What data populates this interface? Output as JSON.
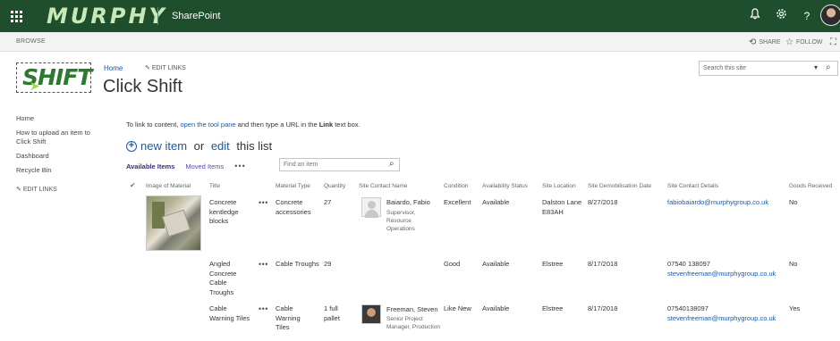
{
  "suite": {
    "brand": "MURPHY",
    "app_name": "SharePoint",
    "icons": [
      "waffle-icon",
      "bell-icon",
      "gear-icon",
      "help-icon",
      "avatar"
    ]
  },
  "ribbon": {
    "browse": "BROWSE",
    "share": "SHARE",
    "follow": "FOLLOW"
  },
  "header": {
    "logo_text": "SHIFT",
    "home": "Home",
    "edit_links": "EDIT LINKS",
    "title": "Click Shift",
    "search_placeholder": "Search this site"
  },
  "left_nav": {
    "items": [
      "Home",
      "How to upload an item to Click Shift",
      "Dashboard",
      "Recycle Bin"
    ],
    "edit_links": "EDIT LINKS"
  },
  "content": {
    "info_prefix": "To link to content, ",
    "info_link": "open the tool pane",
    "info_mid": " and then type a URL in the ",
    "info_bold": "Link",
    "info_suffix": " text box.",
    "new_item": "new item",
    "or": " or ",
    "edit": "edit",
    "this_list": " this list",
    "views": {
      "available": "Available Items",
      "moved": "Moved Items",
      "more": "•••"
    },
    "find_placeholder": "Find an item"
  },
  "table": {
    "headers": [
      "Image of Material",
      "Title",
      "Material Type",
      "Quantity",
      "Site Contact Name",
      "Condition",
      "Availability Status",
      "Site Location",
      "Site Demobilisation Date",
      "Site Contact Details",
      "Goods Received"
    ],
    "rows": [
      {
        "title": "Concrete kentledge blocks",
        "material_type": "Concrete accessories",
        "quantity": "27",
        "contact_name": "Baiardo, Fabio",
        "contact_role": "Supervisor, Resource Operations",
        "condition": "Excellent",
        "availability": "Available",
        "location": "Dalston Lane E83AH",
        "demob_date": "8/27/2018",
        "contact_phone": "",
        "contact_email": "fabiobaiardo@murphygroup.co.uk",
        "goods_received": "No"
      },
      {
        "title": "Angled Concrete Cable Troughs",
        "material_type": "Cable Troughs",
        "quantity": "29",
        "contact_name": "",
        "contact_role": "",
        "condition": "Good",
        "availability": "Available",
        "location": "Elstree",
        "demob_date": "8/17/2018",
        "contact_phone": "07540 138097",
        "contact_email": "stevenfreeman@murphygroup.co.uk",
        "goods_received": "No"
      },
      {
        "title": "Cable Warning Tiles",
        "material_type": "Cable Warning Tiles",
        "quantity": "1 full pallet",
        "contact_name": "Freeman, Steven",
        "contact_role": "Senior Project Manager, Production",
        "condition": "Like New",
        "availability": "Available",
        "location": "Elstree",
        "demob_date": "8/17/2018",
        "contact_phone": "07540138097",
        "contact_email": "stevenfreeman@murphygroup.co.uk",
        "goods_received": "Yes"
      }
    ],
    "row_menu": "•••"
  },
  "colors": {
    "suite_bar": "#1f4e2c",
    "link": "#1a5aa6",
    "view_active": "#3d2a7a"
  }
}
